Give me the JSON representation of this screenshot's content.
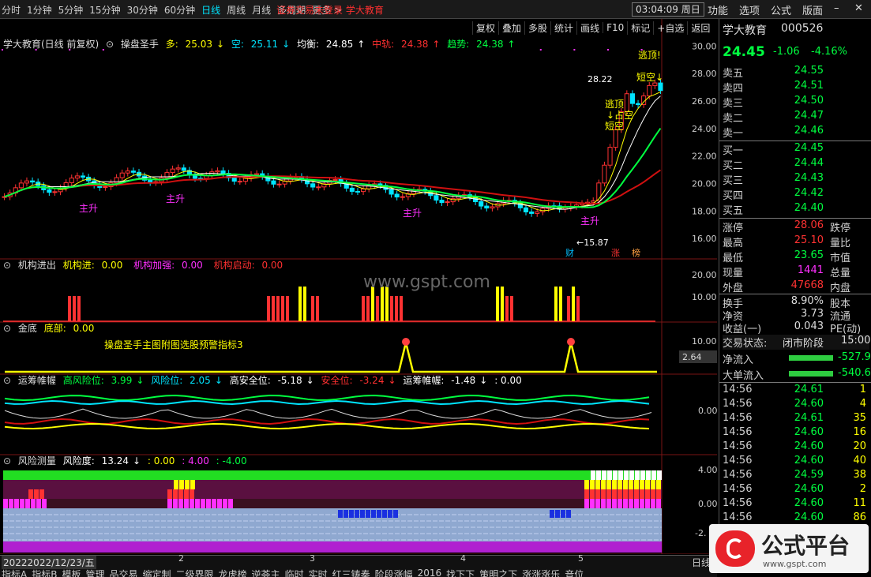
{
  "topbar": {
    "tabs": [
      "分时",
      "1分钟",
      "5分钟",
      "15分钟",
      "30分钟",
      "60分钟",
      "日线",
      "周线",
      "月线",
      "多周期",
      "更多 >"
    ],
    "active": "日线",
    "login_notice": "证券交易未登录  学大教育",
    "clock": "03:04:09 周日",
    "menu": [
      "功能",
      "选项",
      "公式",
      "版面"
    ]
  },
  "toolbar": [
    "复权",
    "叠加",
    "多股",
    "统计",
    "画线",
    "F10",
    "标记",
    "+自选",
    "返回"
  ],
  "main_chart": {
    "stock_title": "学大教育(日线 前复权)",
    "indicator": "操盘圣手",
    "duo_label": "多:",
    "duo": "25.03",
    "kong_label": "空:",
    "kong": "25.11",
    "junheng_label": "均衡:",
    "junheng": "24.85",
    "zhonggui_label": "中轨:",
    "zhonggui": "24.38",
    "qushi_label": "趋势:",
    "qushi": "24.38",
    "y_ticks": [
      "30.00",
      "28.00",
      "26.00",
      "24.00",
      "22.00",
      "20.00",
      "18.00",
      "16.00"
    ],
    "high_mark": "28.22",
    "low_mark": "15.87",
    "signals": [
      "主升",
      "主升",
      "主升",
      "主升",
      "逃顶!",
      "逃顶",
      "↓占空",
      "短空",
      "短空↓"
    ],
    "markers": [
      "财",
      "涨",
      "榜"
    ]
  },
  "panel1": {
    "name": "机构进出",
    "a_label": "机构进:",
    "a": "0.00",
    "b_label": "机构加强:",
    "b": "0.00",
    "c_label": "机构启动:",
    "c": "0.00",
    "y_ticks": [
      "20.00",
      "10.00"
    ],
    "watermark": "www.gspt.com"
  },
  "panel2": {
    "name": "金底",
    "a_label": "底部:",
    "a": "0.00",
    "note": "操盘圣手主图附图选股预警指标3",
    "y_ticks": [
      "10.00"
    ],
    "cursor_value": "2.64"
  },
  "panel3": {
    "name": "运筹帷幄",
    "a_label": "高风险位:",
    "a": "3.99",
    "b_label": "风险位:",
    "b": "2.05",
    "c_label": "高安全位:",
    "c": "-5.18",
    "d_label": "安全位:",
    "d": "-3.24",
    "e_label": "运筹帷幄:",
    "e": "-1.48",
    "f": ": 0.00",
    "y_ticks": [
      "0.00"
    ]
  },
  "panel4": {
    "name": "风险测量",
    "a_label": "风险度:",
    "a": "13.24",
    "b": ": 0.00",
    "c": ": 4.00",
    "d": ": -4.00",
    "y_ticks": [
      "4.00",
      "0.00",
      "-2."
    ]
  },
  "quote": {
    "name": "学大教育",
    "code": "000526",
    "price": "24.45",
    "change": "-1.06",
    "pct": "-4.16%",
    "asks": [
      {
        "label": "卖五",
        "price": "24.55"
      },
      {
        "label": "卖四",
        "price": "24.51"
      },
      {
        "label": "卖三",
        "price": "24.50"
      },
      {
        "label": "卖二",
        "price": "24.47"
      },
      {
        "label": "卖一",
        "price": "24.46"
      }
    ],
    "bids": [
      {
        "label": "买一",
        "price": "24.45"
      },
      {
        "label": "买二",
        "price": "24.44"
      },
      {
        "label": "买三",
        "price": "24.43"
      },
      {
        "label": "买四",
        "price": "24.42"
      },
      {
        "label": "买五",
        "price": "24.40"
      }
    ],
    "stats": [
      {
        "label": "涨停",
        "value": "28.06",
        "label2": "跌停"
      },
      {
        "label": "最高",
        "value": "25.10",
        "label2": "量比"
      },
      {
        "label": "最低",
        "value": "23.65",
        "label2": "市值"
      },
      {
        "label": "现量",
        "value": "1441",
        "label2": "总量"
      },
      {
        "label": "外盘",
        "value": "47668",
        "label2": "内盘"
      }
    ],
    "stats2": [
      {
        "label": "换手",
        "value": "8.90%",
        "label2": "股本"
      },
      {
        "label": "净资",
        "value": "3.73",
        "label2": "流通"
      },
      {
        "label": "收益(一)",
        "value": "0.043",
        "label2": "PE(动)"
      }
    ],
    "status_label": "交易状态:",
    "status": "闭市阶段",
    "status_time": "15:00:",
    "flows": [
      {
        "label": "净流入",
        "value": "-527.9"
      },
      {
        "label": "大单流入",
        "value": "-540.6"
      }
    ],
    "ticks": [
      {
        "t": "14:56",
        "p": "24.61",
        "v": "1"
      },
      {
        "t": "14:56",
        "p": "24.60",
        "v": "4"
      },
      {
        "t": "14:56",
        "p": "24.61",
        "v": "35"
      },
      {
        "t": "14:56",
        "p": "24.60",
        "v": "16"
      },
      {
        "t": "14:56",
        "p": "24.60",
        "v": "20"
      },
      {
        "t": "14:56",
        "p": "24.60",
        "v": "40"
      },
      {
        "t": "14:56",
        "p": "24.59",
        "v": "38"
      },
      {
        "t": "14:56",
        "p": "24.60",
        "v": "2"
      },
      {
        "t": "14:56",
        "p": "24.60",
        "v": "11"
      },
      {
        "t": "14:56",
        "p": "24.60",
        "v": "86"
      }
    ]
  },
  "bottom": {
    "date": "2022/12/23/五",
    "date_prefix": "2022",
    "tabs": [
      "指标A",
      "指标B",
      "模板",
      "管理",
      "品交易",
      "缩定制",
      "二级界限",
      "龙虎榜",
      "逆荟主",
      "临时",
      "实时",
      "红三铸奏",
      "阶段涨幅",
      "2016",
      "找下下",
      "策明之下",
      "涨涨涨乐",
      "音位"
    ],
    "x_ticks": [
      "2",
      "3",
      "4",
      "5"
    ],
    "right_label": "日线"
  },
  "logo": {
    "title": "公式平台",
    "url": "www.gspt.com"
  },
  "colors": {
    "up": "#ff3232",
    "down": "#00e5ff",
    "mid": "#ffff00"
  }
}
